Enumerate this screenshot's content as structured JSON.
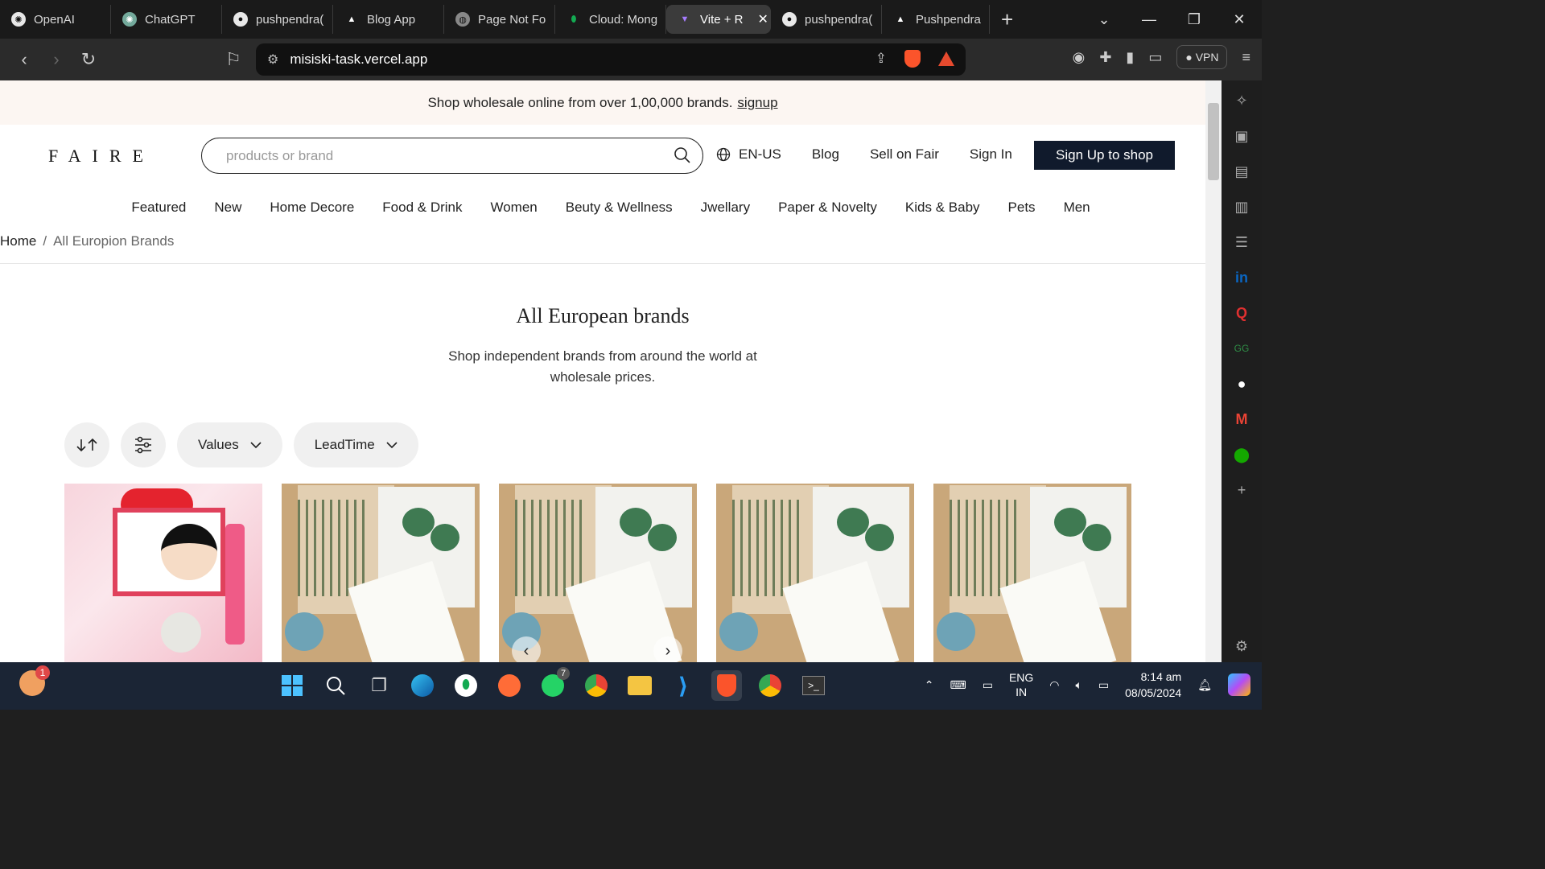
{
  "browser": {
    "tabs": [
      {
        "label": "OpenAI",
        "icon": "openai-icon"
      },
      {
        "label": "ChatGPT",
        "icon": "chatgpt-icon"
      },
      {
        "label": "pushpendra(",
        "icon": "github-icon"
      },
      {
        "label": "Blog App",
        "icon": "vercel-icon"
      },
      {
        "label": "Page Not Fo",
        "icon": "globe-icon"
      },
      {
        "label": "Cloud: Mong",
        "icon": "mongodb-icon"
      },
      {
        "label": "Vite + R",
        "icon": "vite-icon",
        "active": true
      },
      {
        "label": "pushpendra(",
        "icon": "github-icon"
      },
      {
        "label": "Pushpendra",
        "icon": "vercel-icon"
      }
    ],
    "url": "misiski-task.vercel.app",
    "vpn_label": "VPN"
  },
  "promo": {
    "text": "Shop wholesale online from over 1,00,000 brands.",
    "link": "signup"
  },
  "header": {
    "logo": "FAIRE",
    "search_placeholder": "products or brand",
    "lang": "EN-US",
    "blog": "Blog",
    "sell": "Sell on Fair",
    "signin": "Sign In",
    "signup": "Sign Up to shop"
  },
  "categories": [
    "Featured",
    "New",
    "Home Decore",
    "Food & Drink",
    "Women",
    "Beuty & Wellness",
    "Jwellary",
    "Paper & Novelty",
    "Kids & Baby",
    "Pets",
    "Men"
  ],
  "breadcrumb": {
    "home": "Home",
    "separator": "/",
    "current": "All Europion Brands"
  },
  "hero": {
    "title": "All European brands",
    "subtitle": "Shop independent brands from around the world at wholesale prices."
  },
  "filters": {
    "values": "Values",
    "leadtime": "LeadTime"
  },
  "products": [
    {
      "type": "beauty",
      "alt": "Beauty product set"
    },
    {
      "type": "notebook",
      "alt": "Allotment notebook set"
    },
    {
      "type": "notebook",
      "alt": "Allotment notebook set",
      "arrows": true
    },
    {
      "type": "notebook",
      "alt": "Allotment notebook set"
    },
    {
      "type": "notebook",
      "alt": "Allotment notebook set"
    }
  ],
  "taskbar": {
    "notification_count": "1",
    "whatsapp_badge": "7",
    "lang": "ENG",
    "region": "IN",
    "time": "8:14 am",
    "date": "08/05/2024"
  },
  "colors": {
    "signup_bg": "#101a2c",
    "promo_bg": "#fcf6f2",
    "browser_chrome": "#2b2b2b"
  }
}
